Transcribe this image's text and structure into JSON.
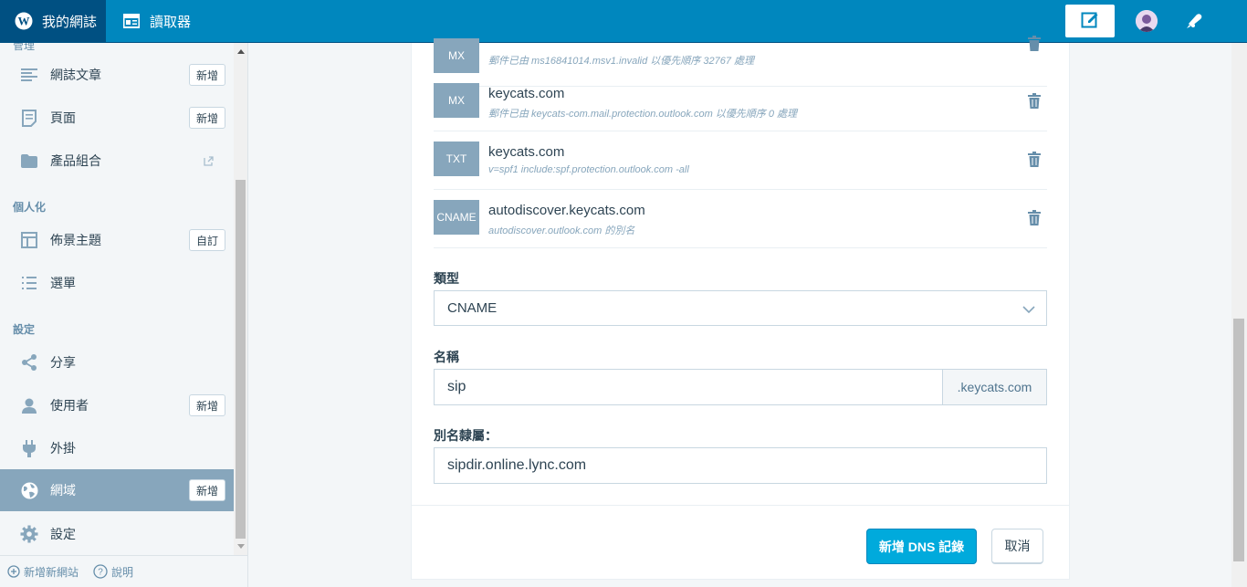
{
  "masterbar": {
    "my_sites": "我的網誌",
    "reader": "讀取器"
  },
  "sidebar": {
    "cut_heading": "管理",
    "items": [
      {
        "label": "網誌文章",
        "badge": "新增"
      },
      {
        "label": "頁面",
        "badge": "新增"
      },
      {
        "label": "產品組合"
      },
      {
        "label": "佈景主題",
        "badge": "自訂"
      },
      {
        "label": "選單"
      },
      {
        "label": "分享"
      },
      {
        "label": "使用者",
        "badge": "新增"
      },
      {
        "label": "外掛"
      },
      {
        "label": "網域",
        "badge": "新增"
      },
      {
        "label": "設定"
      }
    ],
    "headings": {
      "personalize": "個人化",
      "configure": "設定"
    },
    "footer": {
      "add_site": "新增新網站",
      "help": "說明"
    }
  },
  "records": [
    {
      "type": "MX",
      "name": "",
      "desc": "郵件已由 ms16841014.msv1.invalid 以優先順序 32767 處理"
    },
    {
      "type": "MX",
      "name": "keycats.com",
      "desc": "郵件已由 keycats-com.mail.protection.outlook.com 以優先順序 0 處理"
    },
    {
      "type": "TXT",
      "name": "keycats.com",
      "desc": "v=spf1 include:spf.protection.outlook.com -all"
    },
    {
      "type": "CNAME",
      "name": "autodiscover.keycats.com",
      "desc": "autodiscover.outlook.com 的別名"
    }
  ],
  "form": {
    "type_label": "類型",
    "type_value": "CNAME",
    "name_label": "名稱",
    "name_value": "sip",
    "name_suffix": ".keycats.com",
    "alias_label": "別名隸屬：",
    "alias_value": "sipdir.online.lync.com",
    "submit": "新增 DNS 記錄",
    "cancel": "取消"
  },
  "colors": {
    "masterbar": "#0087be",
    "masterbar_active": "#005082",
    "primary_button": "#00aadc",
    "sidebar_selected": "#87a6bc",
    "type_badge": "#87a6bc"
  },
  "icons": [
    "wordpress-icon",
    "reader-icon",
    "write-icon",
    "avatar",
    "notifications-icon",
    "posts-icon",
    "pages-icon",
    "folder-icon",
    "external-link-icon",
    "themes-icon",
    "menus-icon",
    "share-icon",
    "user-icon",
    "plugins-icon",
    "globe-icon",
    "gear-icon",
    "add-circle-icon",
    "help-icon",
    "trash-icon",
    "chevron-down-icon"
  ]
}
